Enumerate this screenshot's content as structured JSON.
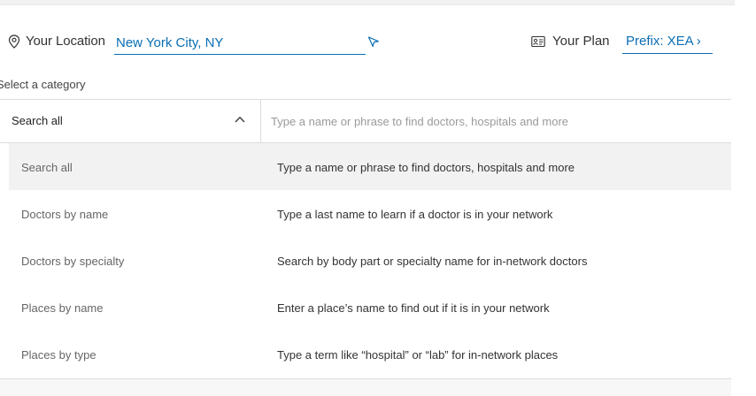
{
  "location": {
    "label": "Your Location",
    "value": "New York City, NY"
  },
  "plan": {
    "label": "Your Plan",
    "link": "Prefix: XEA",
    "chevron": "›"
  },
  "category": {
    "label": "Select a category",
    "selected": "Search all"
  },
  "search": {
    "placeholder": "Type a name or phrase to find doctors, hospitals and more"
  },
  "options": [
    {
      "name": "Search all",
      "desc": "Type a name or phrase to find doctors, hospitals and more"
    },
    {
      "name": "Doctors by name",
      "desc": "Type a last name to learn if a doctor is in your network"
    },
    {
      "name": "Doctors by specialty",
      "desc": "Search by body part or specialty name for in-network doctors"
    },
    {
      "name": "Places by name",
      "desc": "Enter a place’s name to find out if it is in your network"
    },
    {
      "name": "Places by type",
      "desc": "Type a term like “hospital” or “lab” for in-network places"
    }
  ],
  "icons": {
    "location": "map-pin-icon",
    "locate": "navigation-arrow-icon",
    "plan": "id-card-icon",
    "select": "chevron-up-icon"
  },
  "colors": {
    "accent": "#0a6eb4",
    "active_row": "#f2f2f2",
    "divider": "#dcdcdc"
  }
}
